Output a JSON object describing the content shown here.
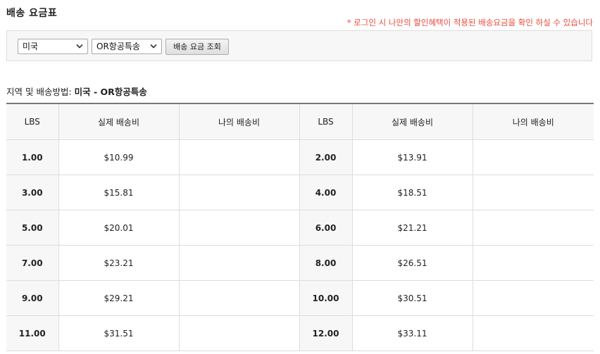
{
  "page": {
    "title": "배송 요금표",
    "login_notice": "* 로그인 시 나만의 할인혜택이 적용된 배송요금을 확인 하실 수 있습니다"
  },
  "filters": {
    "country_selected": "미국",
    "method_selected": "OR항공특송",
    "query_button_label": "배송 요금 조회"
  },
  "region": {
    "label": "지역 및 배송방법:",
    "selection": "미국 - OR항공특송"
  },
  "table": {
    "headers": [
      "LBS",
      "실제 배송비",
      "나의 배송비",
      "LBS",
      "실제 배송비",
      "나의 배송비"
    ],
    "rows": [
      {
        "lbs_left": "1.00",
        "actual_left": "$10.99",
        "my_left": "",
        "lbs_right": "2.00",
        "actual_right": "$13.91",
        "my_right": ""
      },
      {
        "lbs_left": "3.00",
        "actual_left": "$15.81",
        "my_left": "",
        "lbs_right": "4.00",
        "actual_right": "$18.51",
        "my_right": ""
      },
      {
        "lbs_left": "5.00",
        "actual_left": "$20.01",
        "my_left": "",
        "lbs_right": "6.00",
        "actual_right": "$21.21",
        "my_right": ""
      },
      {
        "lbs_left": "7.00",
        "actual_left": "$23.21",
        "my_left": "",
        "lbs_right": "8.00",
        "actual_right": "$26.51",
        "my_right": ""
      },
      {
        "lbs_left": "9.00",
        "actual_left": "$29.21",
        "my_left": "",
        "lbs_right": "10.00",
        "actual_right": "$30.51",
        "my_right": ""
      },
      {
        "lbs_left": "11.00",
        "actual_left": "$31.51",
        "my_left": "",
        "lbs_right": "12.00",
        "actual_right": "$33.11",
        "my_right": ""
      }
    ]
  }
}
